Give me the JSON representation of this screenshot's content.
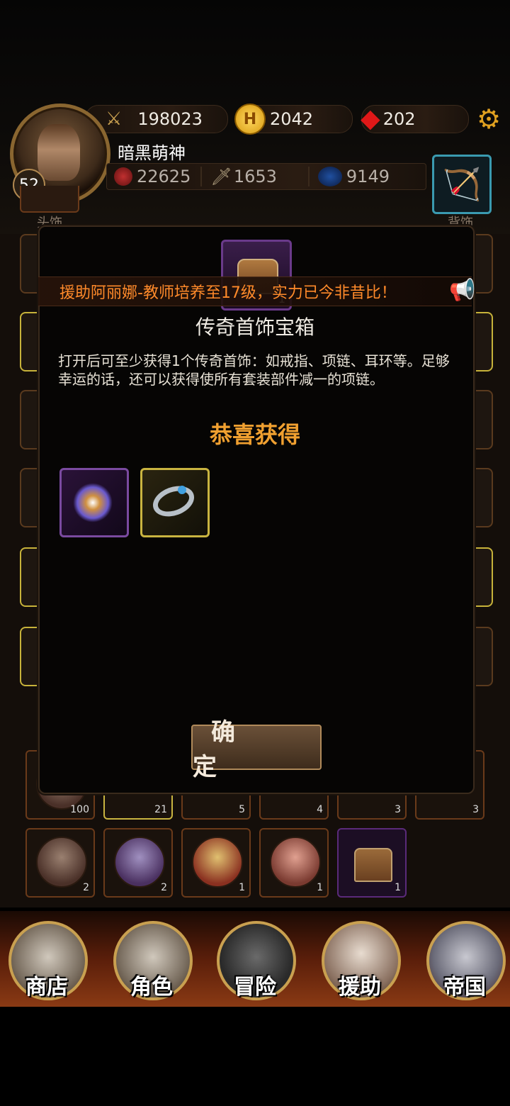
{
  "player": {
    "name": "暗黑萌神",
    "level": "52",
    "power": "198023",
    "gold": "2042",
    "gems": "202",
    "hp": "22625",
    "attack": "1653",
    "mana": "9149"
  },
  "equip_labels": {
    "head": "头饰",
    "back": "背饰"
  },
  "ticker": {
    "text": "援助阿丽娜-教师培养至17级，实力已今非昔比！"
  },
  "dialog": {
    "chest_count": "1",
    "title": "传奇首饰宝箱",
    "description": "打开后可至少获得1个传奇首饰：如戒指、项链、耳环等。足够幸运的话，还可以获得使所有套装部件减一的项链。",
    "congrats": "恭喜获得",
    "confirm": "确　定"
  },
  "reward_items": [
    {
      "icon": "star-necklace-icon",
      "rarity": "purple"
    },
    {
      "icon": "silver-ring-icon",
      "rarity": "gold"
    }
  ],
  "inventory_row1_counts": [
    "100",
    "21",
    "5",
    "4",
    "3",
    "3"
  ],
  "inventory_row2_counts": [
    "2",
    "2",
    "1",
    "1",
    "1"
  ],
  "nav": [
    {
      "label": "商店",
      "icon": "castle-icon"
    },
    {
      "label": "角色",
      "icon": "hooded-figure-icon"
    },
    {
      "label": "冒险",
      "icon": "crossed-swords-icon"
    },
    {
      "label": "援助",
      "icon": "girl-portrait-icon"
    },
    {
      "label": "帝国",
      "icon": "crown-icon"
    }
  ],
  "colors": {
    "accent_orange": "#ff8a2a",
    "congrats": "#f0a030",
    "gold_border": "#c9b440",
    "purple_border": "#7a4aa0"
  }
}
